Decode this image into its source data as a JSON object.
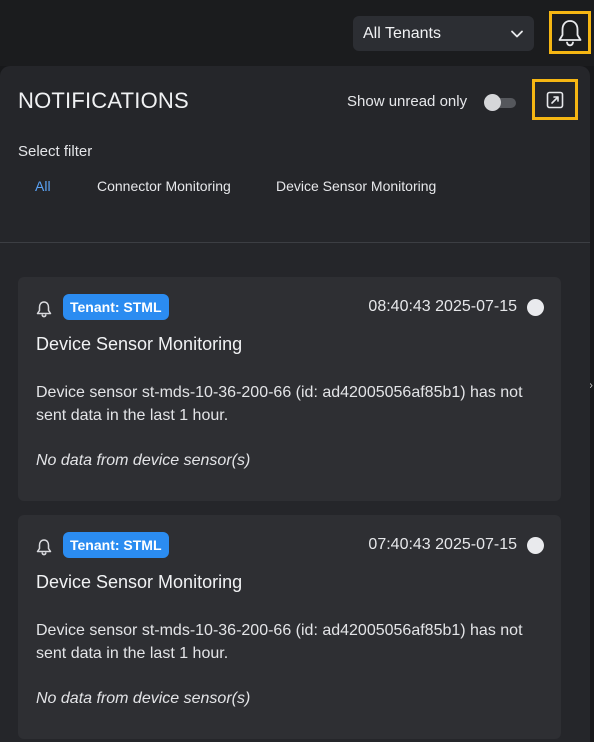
{
  "header": {
    "tenant_select": {
      "value": "All Tenants"
    },
    "bell_icon": "bell-icon"
  },
  "panel": {
    "title": "NOTIFICATIONS",
    "unread_toggle": {
      "label": "Show unread only",
      "on": false
    },
    "expand_icon": "expand-icon",
    "filter_label": "Select filter",
    "filters": [
      "All",
      "Connector Monitoring",
      "Device Sensor Monitoring"
    ],
    "active_filter": "All"
  },
  "notifications": [
    {
      "tenant_badge": "Tenant: STML",
      "time": "08:40:43 2025-07-15",
      "title": "Device Sensor Monitoring",
      "body": "Device sensor st-mds-10-36-200-66 (id: ad42005056af85b1) has not sent data in the last 1 hour.",
      "reason": "No data from device sensor(s)"
    },
    {
      "tenant_badge": "Tenant: STML",
      "time": "07:40:43 2025-07-15",
      "title": "Device Sensor Monitoring",
      "body": "Device sensor st-mds-10-36-200-66 (id: ad42005056af85b1) has not sent data in the last 1 hour.",
      "reason": "No data from device sensor(s)"
    }
  ],
  "colors": {
    "highlight": "#f5b613",
    "accent_blue": "#2b8cf1",
    "active_filter": "#5aa2f5"
  }
}
